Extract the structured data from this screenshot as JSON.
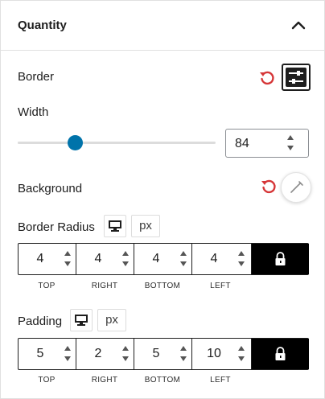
{
  "header": {
    "title": "Quantity"
  },
  "border": {
    "label": "Border"
  },
  "width": {
    "label": "Width",
    "value": "84",
    "slider_fraction": 0.29
  },
  "background": {
    "label": "Background"
  },
  "border_radius": {
    "label": "Border Radius",
    "unit": "px",
    "top": "4",
    "right": "4",
    "bottom": "4",
    "left": "4"
  },
  "padding": {
    "label": "Padding",
    "unit": "px",
    "top": "5",
    "right": "2",
    "bottom": "5",
    "left": "10"
  },
  "sides": {
    "top": "TOP",
    "right": "RIGHT",
    "bottom": "BOTTOM",
    "left": "LEFT"
  },
  "colors": {
    "accent": "#0073aa",
    "reset": "#d63638",
    "dark": "#000000"
  },
  "icons": [
    "chevron-up-icon",
    "reset-icon",
    "sliders-icon",
    "eyedropper-icon",
    "desktop-icon",
    "lock-icon"
  ]
}
